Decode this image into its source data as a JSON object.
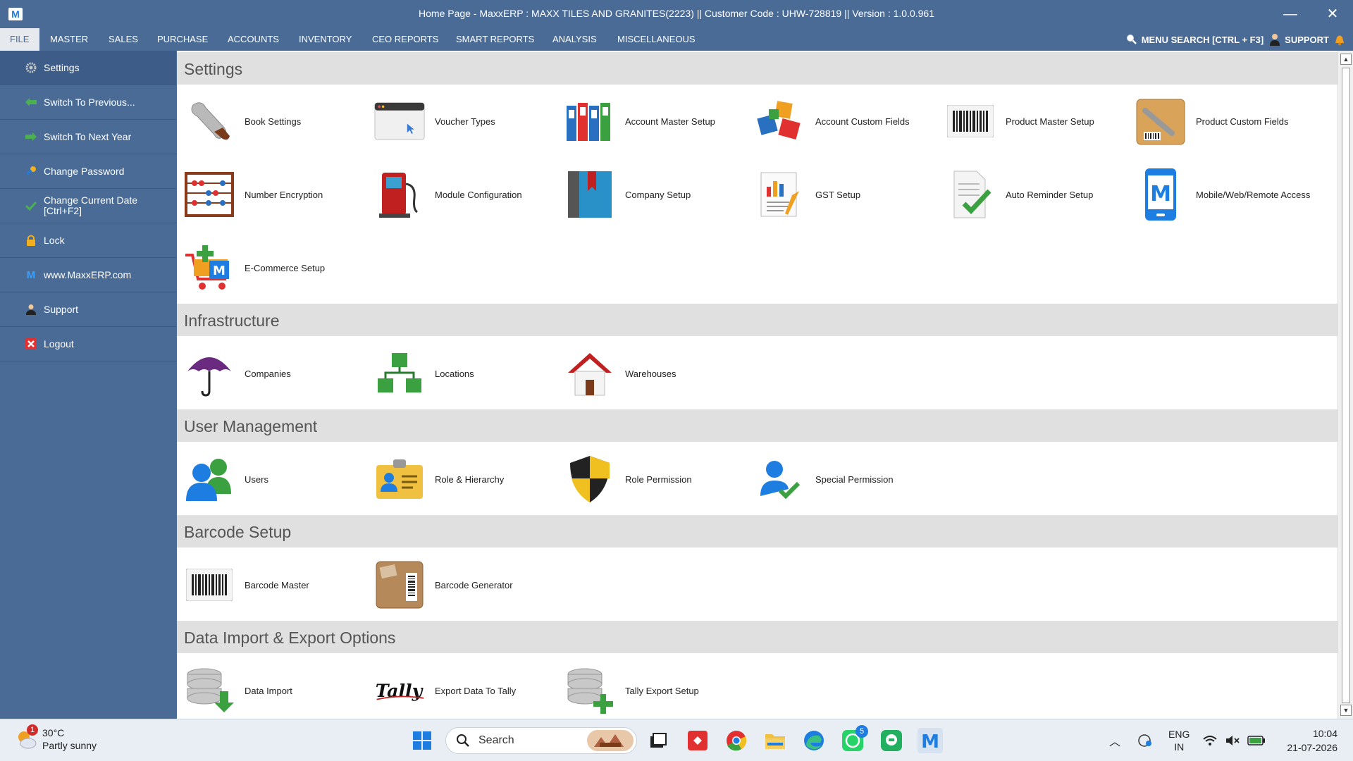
{
  "window": {
    "title": "Home Page - MaxxERP : MAXX TILES AND GRANITES(2223)  ||  Customer Code : UHW-728819  ||  Version : 1.0.0.961",
    "logo_letter": "M",
    "minimize": "—",
    "close": "✕"
  },
  "menu": {
    "items": [
      "FILE",
      "MASTER",
      "SALES",
      "PURCHASE",
      "ACCOUNTS",
      "INVENTORY",
      "CEO REPORTS",
      "SMART REPORTS",
      "ANALYSIS",
      "MISCELLANEOUS"
    ],
    "menu_search": "MENU SEARCH [CTRL + F3]",
    "support": "SUPPORT"
  },
  "sidebar": {
    "items": [
      {
        "label": "Settings",
        "icon": "gear-icon"
      },
      {
        "label": "Switch To Previous...",
        "icon": "arrow-left-icon"
      },
      {
        "label": "Switch To Next Year",
        "icon": "arrow-right-icon"
      },
      {
        "label": "Change Password",
        "icon": "key-icon"
      },
      {
        "label": "Change Current Date",
        "label2": "[Ctrl+F2]",
        "icon": "check-icon"
      },
      {
        "label": "Lock",
        "icon": "lock-icon"
      },
      {
        "label": "www.MaxxERP.com",
        "icon": "maxx-logo-icon"
      },
      {
        "label": "Support",
        "icon": "support-person-icon"
      },
      {
        "label": "Logout",
        "icon": "logout-icon"
      }
    ]
  },
  "sections": {
    "settings": {
      "title": "Settings",
      "tiles": [
        "Book Settings",
        "Voucher Types",
        "Account Master Setup",
        "Account Custom Fields",
        "Product Master Setup",
        "Product Custom Fields",
        "Number Encryption",
        "Module Configuration",
        "Company Setup",
        "GST Setup",
        "Auto Reminder Setup",
        "Mobile/Web/Remote Access",
        "E-Commerce Setup"
      ]
    },
    "infrastructure": {
      "title": "Infrastructure",
      "tiles": [
        "Companies",
        "Locations",
        "Warehouses"
      ]
    },
    "user_management": {
      "title": "User Management",
      "tiles": [
        "Users",
        "Role & Hierarchy",
        "Role Permission",
        "Special Permission"
      ]
    },
    "barcode_setup": {
      "title": "Barcode Setup",
      "tiles": [
        "Barcode Master",
        "Barcode Generator"
      ]
    },
    "data_import_export": {
      "title": "Data Import & Export Options",
      "tiles": [
        "Data Import",
        "Export Data To Tally",
        "Tally Export Setup"
      ]
    }
  },
  "taskbar": {
    "weather_temp": "30°C",
    "weather_desc": "Partly sunny",
    "weather_badge": "1",
    "search_placeholder": "Search",
    "whatsapp_badge": "5",
    "lang_top": "ENG",
    "lang_bottom": "IN",
    "time": "10:04",
    "date": "21-07-2026"
  },
  "colors": {
    "chrome": "#4a6b96",
    "section_header": "#e0e0e0",
    "accent_blue": "#1e7de0"
  }
}
